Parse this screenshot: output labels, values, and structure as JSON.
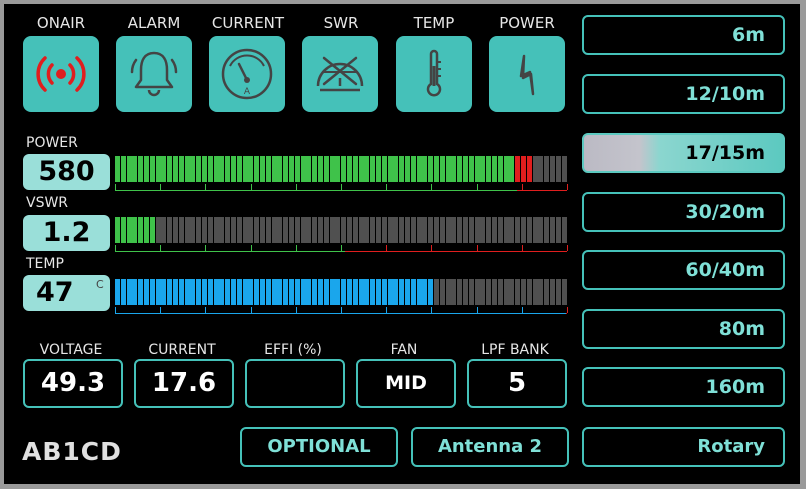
{
  "status_tiles": [
    {
      "label": "ONAIR",
      "icon": "onair-icon"
    },
    {
      "label": "ALARM",
      "icon": "bell-icon"
    },
    {
      "label": "CURRENT",
      "icon": "ammeter-icon"
    },
    {
      "label": "SWR",
      "icon": "swr-meter-icon"
    },
    {
      "label": "TEMP",
      "icon": "thermometer-icon"
    },
    {
      "label": "POWER",
      "icon": "lightning-icon"
    }
  ],
  "meters": {
    "power": {
      "label": "POWER",
      "value": "580",
      "level_segments": 72,
      "total_segments": 78
    },
    "vswr": {
      "label": "VSWR",
      "value": "1.2",
      "level_segments": 7,
      "total_segments": 78
    },
    "temp": {
      "label": "TEMP",
      "value": "47",
      "unit": "C",
      "level_segments": 55,
      "total_segments": 78
    }
  },
  "info": {
    "voltage": {
      "label": "VOLTAGE",
      "value": "49.3"
    },
    "current": {
      "label": "CURRENT",
      "value": "17.6"
    },
    "effi": {
      "label": "EFFI (%)",
      "value": ""
    },
    "fan": {
      "label": "FAN",
      "value": "MID"
    },
    "lpf_bank": {
      "label": "LPF BANK",
      "value": "5"
    }
  },
  "bands": [
    {
      "label": "6m",
      "active": false
    },
    {
      "label": "12/10m",
      "active": false
    },
    {
      "label": "17/15m",
      "active": true
    },
    {
      "label": "30/20m",
      "active": false
    },
    {
      "label": "60/40m",
      "active": false
    },
    {
      "label": "80m",
      "active": false
    },
    {
      "label": "160m",
      "active": false
    }
  ],
  "bottom": {
    "callsign": "AB1CD",
    "optional": "OPTIONAL",
    "antenna": "Antenna 2",
    "rotary": "Rotary"
  },
  "colors": {
    "accent": "#45c1b9",
    "green": "#3fc24a",
    "red": "#e01e1e",
    "blue": "#1aa6ec",
    "inactive": "#505050"
  }
}
